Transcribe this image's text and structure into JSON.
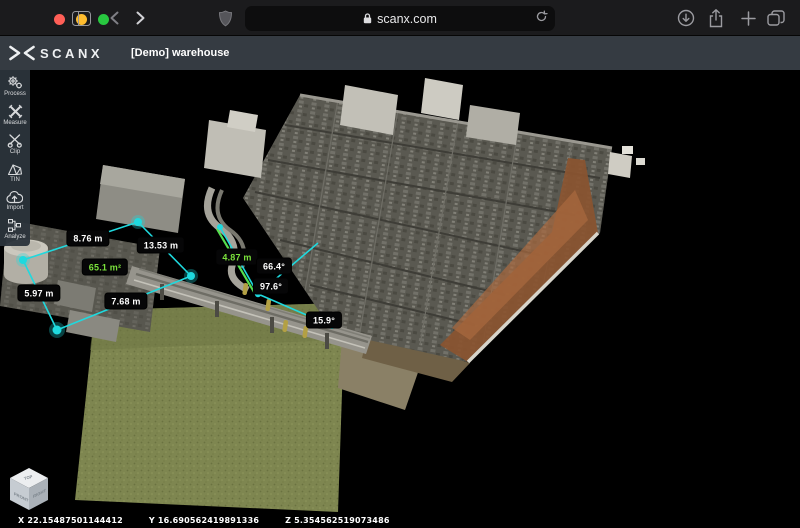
{
  "browser": {
    "url": "scanx.com",
    "traffic_lights": {
      "close": "#ff5f57",
      "minimize": "#febc2e",
      "zoom": "#28c840"
    }
  },
  "header": {
    "logo_text": "SCANX",
    "project_label": "[Demo] warehouse"
  },
  "toolbar": {
    "items": [
      {
        "label": "Process",
        "icon": "gears-icon"
      },
      {
        "label": "Measure",
        "icon": "measure-x-icon"
      },
      {
        "label": "Clip",
        "icon": "scissors-icon"
      },
      {
        "label": "TIN",
        "icon": "tin-mesh-icon"
      },
      {
        "label": "Import",
        "icon": "cloud-upload-icon"
      },
      {
        "label": "Analyze",
        "icon": "analyze-nodes-icon"
      }
    ]
  },
  "measurements": {
    "labels": {
      "d1": "8.76 m",
      "d2": "13.53 m",
      "d3": "5.97 m",
      "d4": "7.68 m",
      "area": "65.1 m²",
      "height": "4.87 m",
      "a1": "66.4°",
      "a2": "97.6°",
      "a3": "15.9°"
    }
  },
  "statusbar": {
    "x": "X 22.15487501144412",
    "y": "Y 16.690562419891336",
    "z": "Z 5.354562519073486"
  },
  "viewcube": {
    "top": "TOP",
    "front": "FRONT",
    "right": "RIGHT"
  },
  "theme": {
    "cyan": "#1fd9de",
    "green": "#55e04e",
    "label-bg": "#060607",
    "chrome-bg": "#1b1b1d",
    "appbar-bg": "#353b42",
    "toolbar-bg": "#2c343c"
  }
}
